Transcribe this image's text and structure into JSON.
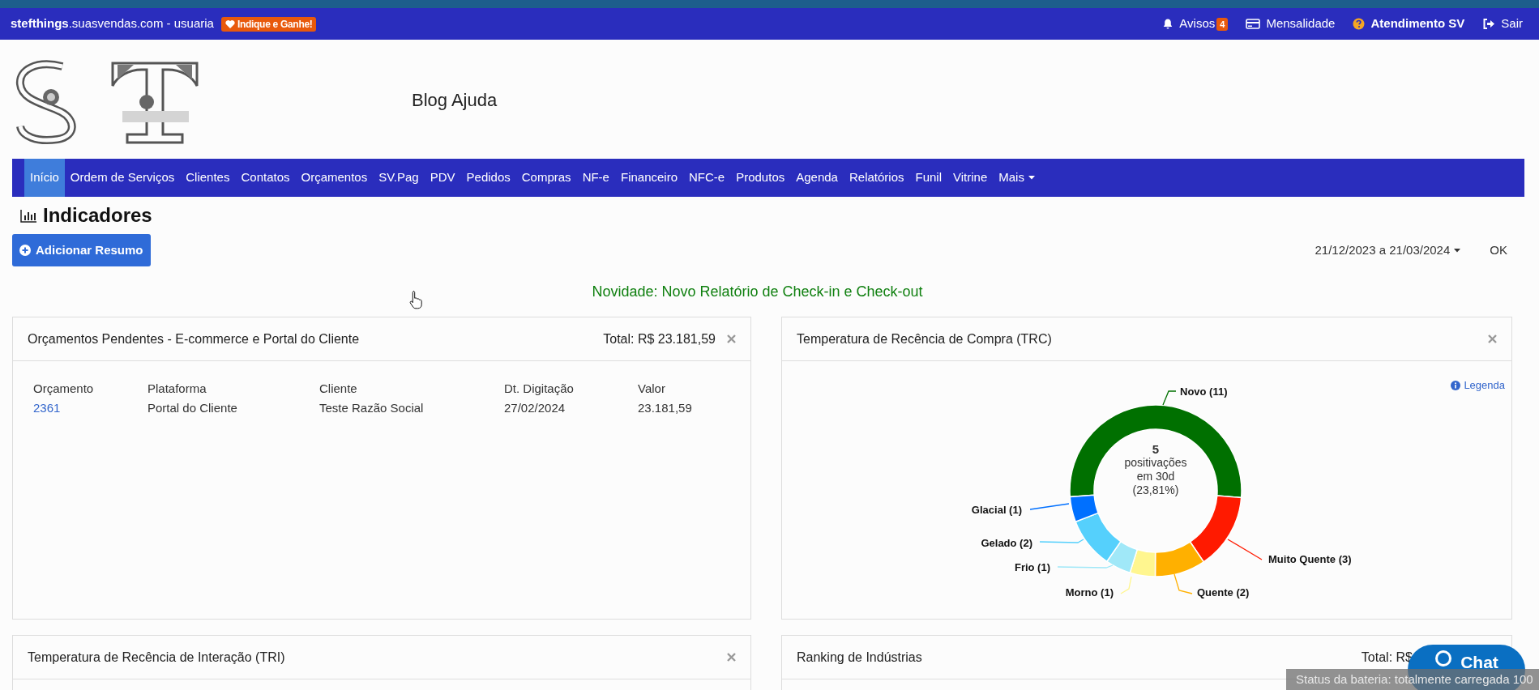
{
  "topbar": {
    "site": "**stefthings**.suasvendas.com - usuaria",
    "promo": "Indique e Ganhe!",
    "links": [
      {
        "kind": "bell",
        "label": "Avisos",
        "badge": "4"
      },
      {
        "kind": "card",
        "label": "Mensalidade"
      },
      {
        "kind": "help",
        "label": "Atendimento SV"
      },
      {
        "kind": "exit",
        "label": "Sair"
      }
    ]
  },
  "header": {
    "blog_link": "Blog Ajuda"
  },
  "nav": [
    {
      "label": "Início",
      "selected": true,
      "dropdown": false
    },
    {
      "label": "Ordem de Serviços",
      "selected": false,
      "dropdown": false
    },
    {
      "label": "Clientes",
      "selected": false,
      "dropdown": false
    },
    {
      "label": "Contatos",
      "selected": false,
      "dropdown": false
    },
    {
      "label": "Orçamentos",
      "selected": false,
      "dropdown": false
    },
    {
      "label": "SV.Pag",
      "selected": false,
      "dropdown": false
    },
    {
      "label": "PDV",
      "selected": false,
      "dropdown": false
    },
    {
      "label": "Pedidos",
      "selected": false,
      "dropdown": false
    },
    {
      "label": "Compras",
      "selected": false,
      "dropdown": false
    },
    {
      "label": "NF-e",
      "selected": false,
      "dropdown": false
    },
    {
      "label": "Financeiro",
      "selected": false,
      "dropdown": false
    },
    {
      "label": "NFC-e",
      "selected": false,
      "dropdown": false
    },
    {
      "label": "Produtos",
      "selected": false,
      "dropdown": false
    },
    {
      "label": "Agenda",
      "selected": false,
      "dropdown": false
    },
    {
      "label": "Relatórios",
      "selected": false,
      "dropdown": false
    },
    {
      "label": "Funil",
      "selected": false,
      "dropdown": false
    },
    {
      "label": "Vitrine",
      "selected": false,
      "dropdown": false
    },
    {
      "label": "Mais",
      "selected": false,
      "dropdown": true
    }
  ],
  "page_title": "Indicadores",
  "add_button": "Adicionar Resumo",
  "date_range": "21/12/2023 a 21/03/2024",
  "ok_button": "OK",
  "news": "Novidade: Novo Relatório de Check-in e Check-out",
  "cards": [
    {
      "kind": "table",
      "closable": true,
      "title": "Orçamentos Pendentes - E-commerce e Portal do Cliente",
      "total": "Total: R$ 23.181,59",
      "columns": [
        "Orçamento",
        "Plataforma",
        "Cliente",
        "Dt. Digitação",
        "Valor"
      ],
      "rows": [
        [
          "2361",
          "Portal do Cliente",
          "Teste Razão Social",
          "27/02/2024",
          "23.181,59"
        ]
      ]
    },
    {
      "kind": "donut",
      "closable": true,
      "title": "Temperatura de Recência de Compra (TRC)",
      "legend_link": "Legenda",
      "center": [
        "5",
        "positivações",
        "em 30d",
        "(23,81%)"
      ],
      "chart_data": {
        "type": "donut",
        "categories": [
          "Novo (11)",
          "Muito Quente (3)",
          "Quente (2)",
          "Morno (1)",
          "Frio (1)",
          "Gelado (2)",
          "Glacial (1)"
        ],
        "values": [
          11,
          3,
          2,
          1,
          1,
          2,
          1
        ],
        "colors": [
          "#007000",
          "#ff1a00",
          "#ffb000",
          "#fff68f",
          "#a0e8f8",
          "#55d0fc",
          "#0070ff"
        ]
      }
    },
    {
      "kind": "empty",
      "closable": true,
      "title": "Temperatura de Recência de Interação (TRI)"
    },
    {
      "kind": "empty",
      "closable": false,
      "title": "Ranking de Indústrias",
      "total": "Total: R$"
    }
  ],
  "chat_button": "Chat",
  "tooltip": "Status da bateria: totalmente carregada 100"
}
